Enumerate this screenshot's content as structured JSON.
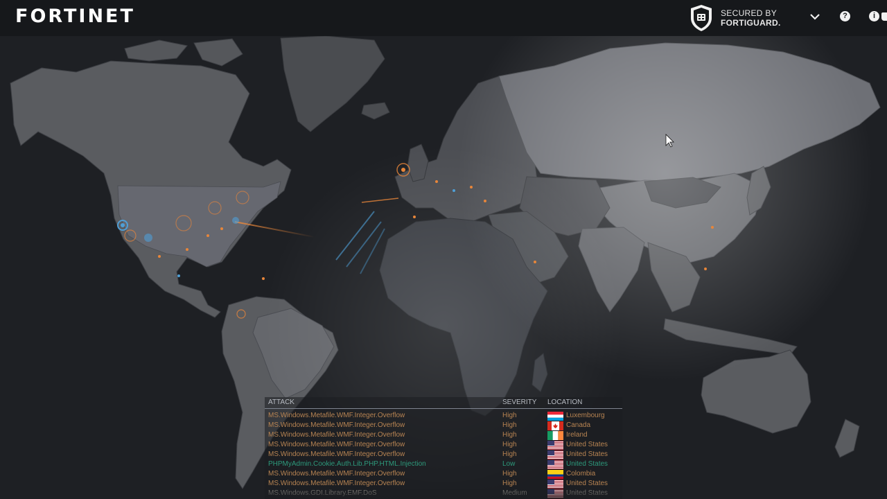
{
  "header": {
    "logo_text": "FORTINET",
    "secured_line1": "SECURED BY",
    "secured_line2": "FORTIGUARD.",
    "help_glyph": "?",
    "info_glyph": "i"
  },
  "icons": {
    "shield": "shield-icon",
    "dropdown": "chevron-down-icon",
    "help": "help-icon",
    "info": "info-icon",
    "cursor": "mouse-cursor-icon"
  },
  "colors": {
    "background": "#1b1d20",
    "land": "#5a5c60",
    "ocean": "#25282c",
    "attack_orange": "#e8863a",
    "attack_blue": "#4f9fd6",
    "severity_high": "#b88452",
    "severity_low": "#2d9a7c"
  },
  "feed": {
    "columns": {
      "attack": "ATTACK",
      "severity": "SEVERITY",
      "location": "LOCATION"
    },
    "rows": [
      {
        "attack": "MS.Windows.Metafile.WMF.Integer.Overflow",
        "severity": "High",
        "location": "Luxembourg",
        "flag": "lu"
      },
      {
        "attack": "MS.Windows.Metafile.WMF.Integer.Overflow",
        "severity": "High",
        "location": "Canada",
        "flag": "ca"
      },
      {
        "attack": "MS.Windows.Metafile.WMF.Integer.Overflow",
        "severity": "High",
        "location": "Ireland",
        "flag": "ie"
      },
      {
        "attack": "MS.Windows.Metafile.WMF.Integer.Overflow",
        "severity": "High",
        "location": "United States",
        "flag": "us"
      },
      {
        "attack": "MS.Windows.Metafile.WMF.Integer.Overflow",
        "severity": "High",
        "location": "United States",
        "flag": "us"
      },
      {
        "attack": "PHPMyAdmin.Cookie.Auth.Lib.PHP.HTML.Injection",
        "severity": "Low",
        "location": "United States",
        "flag": "us"
      },
      {
        "attack": "MS.Windows.Metafile.WMF.Integer.Overflow",
        "severity": "High",
        "location": "Colombia",
        "flag": "co"
      },
      {
        "attack": "MS.Windows.Metafile.WMF.Integer.Overflow",
        "severity": "High",
        "location": "United States",
        "flag": "us"
      },
      {
        "attack": "MS.Windows.GDI.Library.EMF.DoS",
        "severity": "Medium",
        "location": "United States",
        "flag": "us"
      }
    ]
  }
}
